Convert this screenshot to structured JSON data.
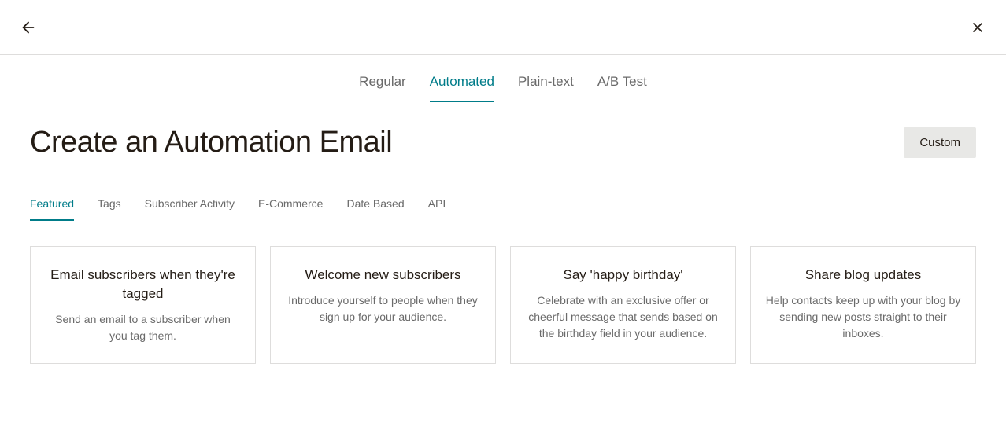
{
  "header": {
    "tabs": [
      {
        "label": "Regular",
        "active": false
      },
      {
        "label": "Automated",
        "active": true
      },
      {
        "label": "Plain-text",
        "active": false
      },
      {
        "label": "A/B Test",
        "active": false
      }
    ]
  },
  "page": {
    "title": "Create an Automation Email",
    "custom_button": "Custom"
  },
  "sub_tabs": [
    {
      "label": "Featured",
      "active": true
    },
    {
      "label": "Tags",
      "active": false
    },
    {
      "label": "Subscriber Activity",
      "active": false
    },
    {
      "label": "E-Commerce",
      "active": false
    },
    {
      "label": "Date Based",
      "active": false
    },
    {
      "label": "API",
      "active": false
    }
  ],
  "cards": [
    {
      "title": "Email subscribers when they're tagged",
      "description": "Send an email to a subscriber when you tag them."
    },
    {
      "title": "Welcome new subscribers",
      "description": "Introduce yourself to people when they sign up for your audience."
    },
    {
      "title": "Say 'happy birthday'",
      "description": "Celebrate with an exclusive offer or cheerful message that sends based on the birthday field in your audience."
    },
    {
      "title": "Share blog updates",
      "description": "Help contacts keep up with your blog by sending new posts straight to their inboxes."
    }
  ]
}
